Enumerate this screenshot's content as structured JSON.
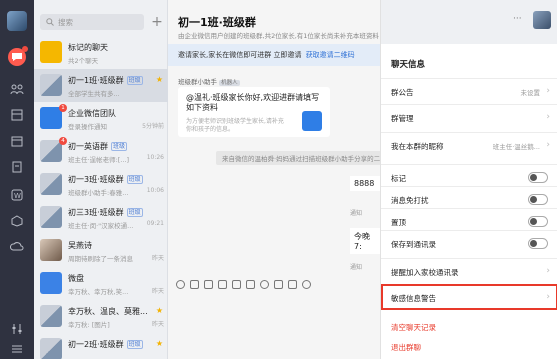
{
  "list": {
    "search_placeholder": "搜索",
    "plus": "+",
    "items": [
      {
        "name": "标记的聊天",
        "tag": "",
        "sub": "共2个聊天",
        "time": "",
        "unread": "",
        "star": false,
        "thumb": "star"
      },
      {
        "name": "初一1班·班级群",
        "tag": "班级",
        "sub": "全部学生共有多...",
        "time": "",
        "unread": "",
        "star": true,
        "thumb": "group"
      },
      {
        "name": "企业微信团队",
        "tag": "",
        "sub": "登录操作通知",
        "time": "5分钟前",
        "unread": "1",
        "star": false,
        "thumb": "wecom"
      },
      {
        "name": "初一英语群",
        "tag": "班级",
        "sub": "班主任·逞帐老师:[...]",
        "time": "10:26",
        "unread": "4",
        "star": false,
        "thumb": "group"
      },
      {
        "name": "初一3班·班级群",
        "tag": "班级",
        "sub": "班级群小助手:春雅...",
        "time": "10:06",
        "unread": "",
        "star": false,
        "thumb": "group"
      },
      {
        "name": "初三3班·班级群",
        "tag": "班级",
        "sub": "班主任·闵·\"汉家校通...",
        "time": "09:21",
        "unread": "",
        "star": false,
        "thumb": "group"
      },
      {
        "name": "吴燕诗",
        "tag": "",
        "sub": "周期待刷除了一条消息",
        "time": "昨天",
        "unread": "",
        "star": false,
        "thumb": "person"
      },
      {
        "name": "微盘",
        "tag": "",
        "sub": "幸万秋、幸万秋,笑...",
        "time": "昨天",
        "unread": "",
        "star": false,
        "thumb": "drive"
      },
      {
        "name": "幸万秋、温良、莫雅...",
        "tag": "",
        "sub": "幸万秋: [图片]",
        "time": "昨天",
        "unread": "",
        "star": true,
        "thumb": "group"
      },
      {
        "name": "初一2班·班级群",
        "tag": "班级",
        "sub": "",
        "time": "",
        "unread": "",
        "star": true,
        "thumb": "group"
      }
    ]
  },
  "chat": {
    "title": "初一1班·班级群",
    "description": "由企业微信用户创建的班级群,共2位家长,有1位家长尚未补充本班资料 | 群主: 班主任·温丝鹅老师",
    "notice": "邀请家长,家长在微信即可进群 立即邀请",
    "notice_link": "获取邀请二维码",
    "bot_label": "班级群小助手",
    "bot_badge": "机器人",
    "card_heading": "@温礼·班级家长你好,欢迎进群请填写如下资料",
    "card_sub": "为方便老师识别班级学生家长,请补充你和孩子的信息。",
    "system_msg": "来自微信的温柏舜·妈妈通过扫描班级群小助手分享的二维码",
    "peek_1": "8888",
    "peek_1_small": "通知",
    "peek_2": "今晚7:",
    "peek_2_small": "通知"
  },
  "info": {
    "title": "聊天信息",
    "rows": [
      {
        "label": "群公告",
        "value": "未设置",
        "kind": "chevron"
      },
      {
        "label": "群管理",
        "value": "",
        "kind": "chevron"
      },
      {
        "label": "我在本群的昵称",
        "value": "班主任·温丝鹅...",
        "kind": "chevron"
      },
      {
        "label": "标记",
        "value": "",
        "kind": "toggle"
      },
      {
        "label": "消息免打扰",
        "value": "",
        "kind": "toggle"
      },
      {
        "label": "置顶",
        "value": "",
        "kind": "toggle"
      },
      {
        "label": "保存到通讯录",
        "value": "",
        "kind": "toggle"
      },
      {
        "label": "提醒加入家校通讯录",
        "value": "",
        "kind": "chevron"
      },
      {
        "label": "敏感信息警告",
        "value": "",
        "kind": "chevron"
      }
    ],
    "clear_history": "清空聊天记录",
    "leave_group": "退出群聊"
  },
  "colors": {
    "rail": "#2f3240",
    "accent": "#3273d6",
    "danger": "#e8392a",
    "highlight": "#e8392a"
  }
}
